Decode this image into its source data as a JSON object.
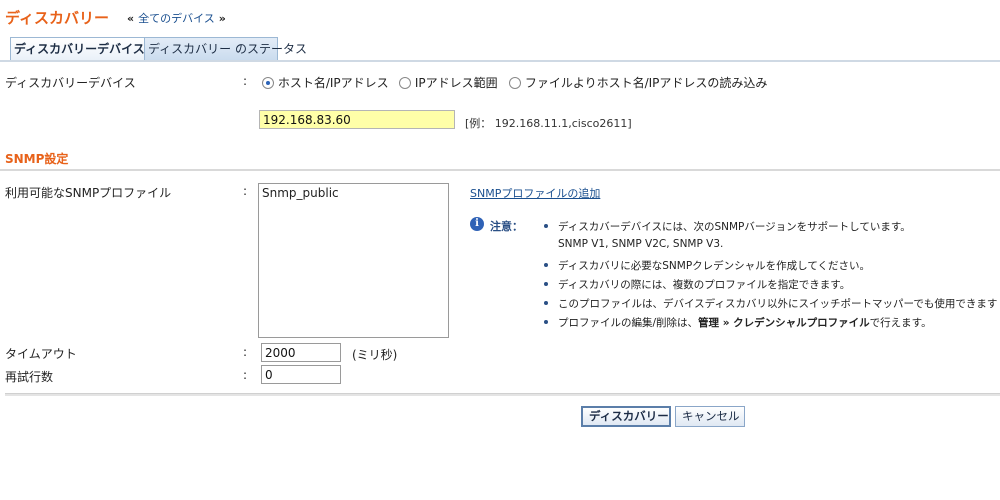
{
  "header": {
    "title": "ディスカバリー",
    "back_prefix": "«",
    "back_link": "全てのデバイス",
    "back_suffix": "»"
  },
  "tabs": [
    {
      "label": "ディスカバリーデバイス",
      "active": true
    },
    {
      "label": "ディスカバリー のステータス",
      "active": false
    }
  ],
  "discovery": {
    "label": "ディスカバリーデバイス",
    "colon": ":",
    "options": [
      {
        "label": "ホスト名/IPアドレス",
        "selected": true
      },
      {
        "label": "IPアドレス範囲",
        "selected": false
      },
      {
        "label": "ファイルよりホスト名/IPアドレスの読み込み",
        "selected": false
      }
    ],
    "host_value": "192.168.83.60",
    "example": "[例： 192.168.11.1,cisco2611]"
  },
  "snmp": {
    "section_title": "SNMP設定",
    "profiles_label": "利用可能なSNMPプロファイル",
    "colon": ":",
    "profiles": [
      "Snmp_public"
    ],
    "add_link": "SNMPプロファイルの追加",
    "note_label": "注意：",
    "notes": [
      "ディスカバーデバイスには、次のSNMPバージョンをサポートしています。",
      "SNMP V1, SNMP V2C, SNMP V3.",
      "ディスカバリに必要なSNMPクレデンシャルを作成してください。",
      "ディスカバリの際には、複数のプロファイルを指定できます。",
      "このプロファイルは、デバイスディスカバリ以外にスイッチポートマッパーでも使用できます",
      "プロファイルの編集/削除は、",
      "管理 » クレデンシャルプロファイル",
      "で行えます。"
    ]
  },
  "timeout": {
    "label": "タイムアウト",
    "colon": ":",
    "value": "2000",
    "unit": "(ミリ秒)"
  },
  "retries": {
    "label": "再試行数",
    "colon": ":",
    "value": "0"
  },
  "buttons": {
    "discover": "ディスカバリー",
    "cancel": "キャンセル"
  },
  "colors": {
    "accent": "#e8621a",
    "link": "#1a4f8f",
    "highlight_input": "#ffffa8"
  }
}
